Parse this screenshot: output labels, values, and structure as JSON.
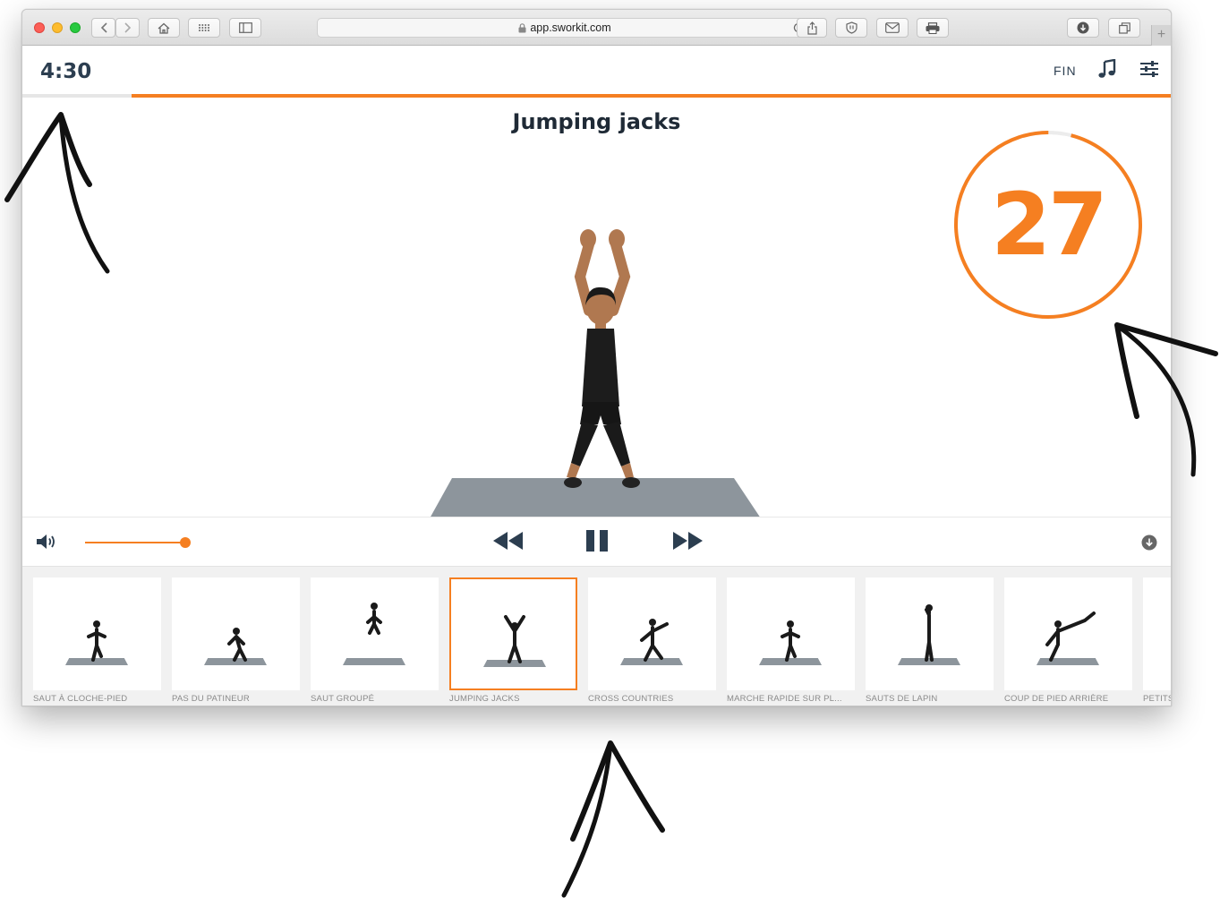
{
  "browser": {
    "url": "app.sworkit.com"
  },
  "header": {
    "timer": "4:30",
    "fin_label": "FIN",
    "progress_fraction": 0.905
  },
  "exercise": {
    "title": "Jumping jacks",
    "rep_counter": "27",
    "counter_fraction": 0.96
  },
  "controls": {
    "volume_level": 1.0
  },
  "strip": {
    "items": [
      {
        "label": "SAUT À CLOCHE-PIED",
        "active": false
      },
      {
        "label": "PAS DU PATINEUR",
        "active": false
      },
      {
        "label": "SAUT GROUPÉ",
        "active": false
      },
      {
        "label": "JUMPING JACKS",
        "active": true
      },
      {
        "label": "CROSS COUNTRIES",
        "active": false
      },
      {
        "label": "MARCHE RAPIDE SUR PL...",
        "active": false
      },
      {
        "label": "SAUTS DE LAPIN",
        "active": false
      },
      {
        "label": "COUP DE PIED ARRIÈRE",
        "active": false
      },
      {
        "label": "PETITS",
        "active": false
      }
    ]
  },
  "colors": {
    "accent": "#f57f21",
    "title": "#1f2a36",
    "strip_bg": "#f1f1f1"
  },
  "icons": [
    "back-icon",
    "forward-icon",
    "home-icon",
    "grid-icon",
    "sidebar-icon",
    "lock-icon",
    "reload-icon",
    "share-icon",
    "shield-icon",
    "mail-icon",
    "print-icon",
    "download-icon",
    "tabs-icon",
    "music-icon",
    "settings-icon",
    "volume-icon",
    "rewind-icon",
    "pause-icon",
    "fast-forward-icon",
    "scroll-down-icon"
  ]
}
